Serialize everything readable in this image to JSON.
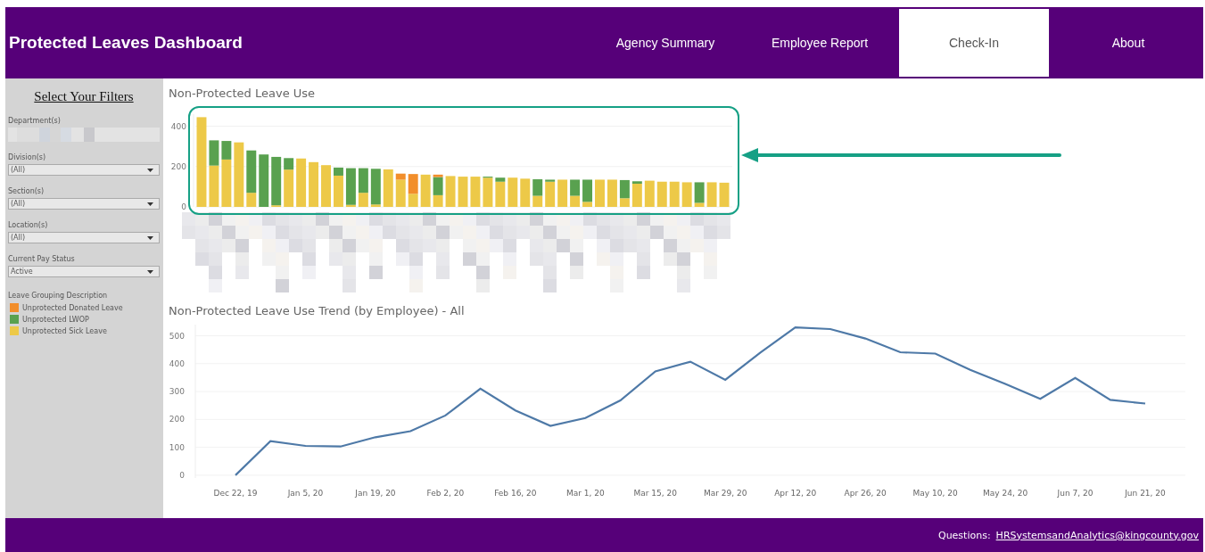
{
  "header": {
    "title": "Protected Leaves Dashboard",
    "nav": [
      {
        "label": "Agency Summary",
        "selected": false
      },
      {
        "label": "Employee Report",
        "selected": false
      },
      {
        "label": "Check-In",
        "selected": true
      },
      {
        "label": "About",
        "selected": false
      }
    ]
  },
  "sidebar": {
    "heading": "Select Your Filters",
    "department_label": "Department(s)",
    "filters": [
      {
        "label": "Division(s)",
        "value": "(All)"
      },
      {
        "label": "Section(s)",
        "value": "(All)"
      },
      {
        "label": "Location(s)",
        "value": "(All)"
      },
      {
        "label": "Current Pay Status",
        "value": "Active"
      }
    ],
    "legend_title": "Leave Grouping Description"
  },
  "bar_panel": {
    "title": "Non-Protected Leave Use",
    "chart_data": {
      "type": "bar",
      "stacked": true,
      "grid": true,
      "ylim": [
        0,
        460
      ],
      "yticks": [
        0,
        200,
        400
      ],
      "series": [
        {
          "name": "Unprotected Sick Leave",
          "color": "#edc948",
          "values": [
            445,
            205,
            235,
            320,
            70,
            0,
            8,
            185,
            240,
            222,
            207,
            155,
            10,
            70,
            12,
            186,
            135,
            65,
            160,
            58,
            153,
            150,
            150,
            145,
            125,
            145,
            140,
            55,
            125,
            135,
            55,
            25,
            135,
            135,
            43,
            115,
            130,
            125,
            125,
            122,
            20,
            122,
            120
          ]
        },
        {
          "name": "Unprotected LWOP",
          "color": "#59a14f",
          "values": [
            0,
            125,
            92,
            0,
            210,
            260,
            240,
            57,
            0,
            0,
            0,
            40,
            182,
            122,
            177,
            0,
            0,
            0,
            0,
            90,
            0,
            0,
            0,
            5,
            20,
            0,
            0,
            82,
            10,
            0,
            80,
            110,
            0,
            0,
            90,
            12,
            0,
            0,
            0,
            0,
            102,
            0,
            0
          ]
        },
        {
          "name": "Unprotected Donated Leave",
          "color": "#f28e2b",
          "values": [
            0,
            0,
            0,
            0,
            0,
            0,
            0,
            0,
            0,
            0,
            0,
            0,
            0,
            0,
            0,
            0,
            30,
            98,
            0,
            12,
            0,
            0,
            0,
            0,
            0,
            0,
            0,
            0,
            0,
            0,
            0,
            0,
            0,
            0,
            0,
            0,
            0,
            0,
            0,
            0,
            0,
            0,
            0
          ]
        }
      ]
    }
  },
  "trend_panel": {
    "title": "Non-Protected Leave Use Trend (by Employee) - All",
    "chart_data": {
      "type": "line",
      "grid": true,
      "ylim": [
        -10,
        540
      ],
      "yticks": [
        0,
        100,
        200,
        300,
        400,
        500
      ],
      "categories": [
        "Dec 22, 19",
        null,
        "Jan 5, 20",
        null,
        "Jan 19, 20",
        null,
        "Feb 2, 20",
        null,
        "Feb 16, 20",
        null,
        "Mar 1, 20",
        null,
        "Mar 15, 20",
        null,
        "Mar 29, 20",
        null,
        "Apr 12, 20",
        null,
        "Apr 26, 20",
        null,
        "May 10, 20",
        null,
        "May 24, 20",
        null,
        "Jun 7, 20",
        null,
        "Jun 21, 20"
      ],
      "series": [
        {
          "color": "#4e79a7",
          "values": [
            0,
            122,
            105,
            103,
            136,
            158,
            214,
            310,
            232,
            177,
            205,
            268,
            372,
            407,
            342,
            440,
            530,
            524,
            490,
            441,
            436,
            378,
            327,
            274,
            349,
            270,
            257
          ]
        }
      ]
    }
  },
  "footer": {
    "label": "Questions:",
    "link": "HRSystemsandAnalytics@kingcounty.gov"
  }
}
